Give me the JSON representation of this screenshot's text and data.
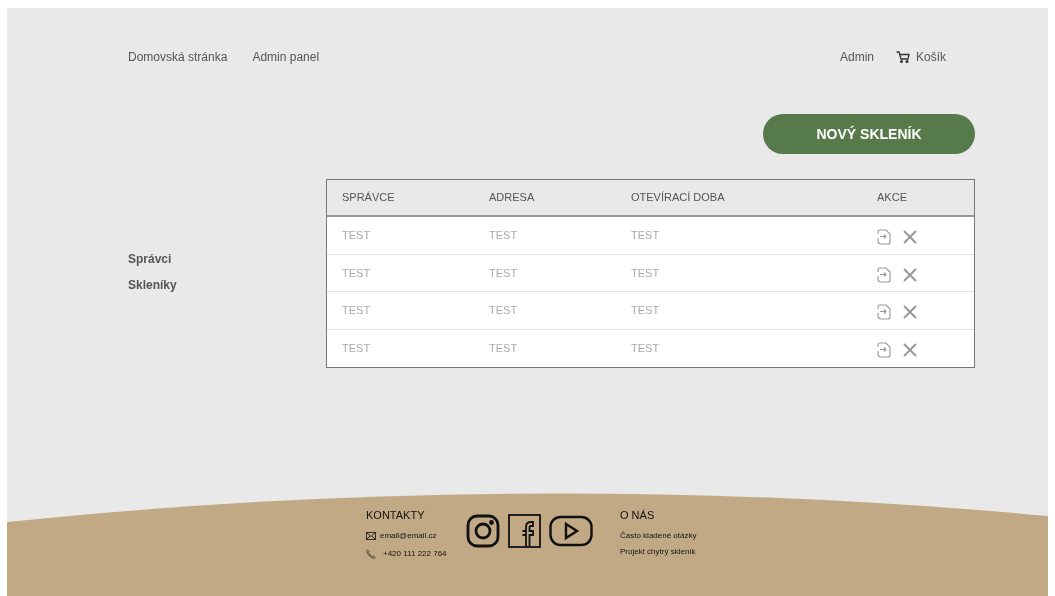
{
  "nav": {
    "links": [
      "Domovská stránka",
      "Admin panel"
    ],
    "user": "Admin",
    "cart": "Košík"
  },
  "new_button": "NOVÝ SKLENÍK",
  "sidebar": {
    "items": [
      "Správci",
      "Skleníky"
    ]
  },
  "table": {
    "columns": [
      "SPRÁVCE",
      "ADRESA",
      "OTEVÍRACÍ DOBA",
      "AKCE"
    ],
    "rows": [
      [
        "TEST",
        "TEST",
        "TEST"
      ],
      [
        "TEST",
        "TEST",
        "TEST"
      ],
      [
        "TEST",
        "TEST",
        "TEST"
      ],
      [
        "TEST",
        "TEST",
        "TEST"
      ]
    ]
  },
  "footer": {
    "contacts": {
      "title": "KONTAKTY",
      "email": "email@email.cz",
      "phone": "+420 111 222 764"
    },
    "about": {
      "title": "O NÁS",
      "links": [
        "Často kladené otázky",
        "Projekt chytrý skleník"
      ]
    }
  }
}
